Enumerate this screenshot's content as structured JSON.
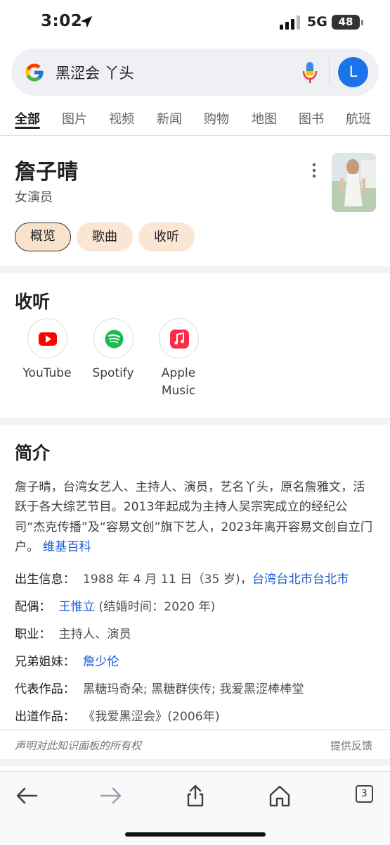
{
  "status_bar": {
    "time": "3:02",
    "network": "5G",
    "battery": "48"
  },
  "search": {
    "query": "黑涩会 丫头",
    "avatar_letter": "L"
  },
  "tabs": [
    "全部",
    "图片",
    "视频",
    "新闻",
    "购物",
    "地图",
    "图书",
    "航班"
  ],
  "entity": {
    "name": "詹子晴",
    "subtitle": "女演员",
    "chips": [
      "概览",
      "歌曲",
      "收听"
    ]
  },
  "listen": {
    "title": "收听",
    "apps": [
      {
        "label": "YouTube",
        "icon": "youtube-icon",
        "color": "#ff0000"
      },
      {
        "label": "Spotify",
        "icon": "spotify-icon",
        "color": "#1db954"
      },
      {
        "label": "Apple Music",
        "icon": "apple-music-icon",
        "color": "#fa2d48"
      }
    ]
  },
  "intro": {
    "title": "简介",
    "text": "詹子晴，台湾女艺人、主持人、演员，艺名丫头，原名詹雅文，活跃于各大综艺节目。2013年起成为主持人吴宗宪成立的经纪公司“杰克传播”及“容易文创”旗下艺人，2023年离开容易文创自立门户。",
    "source": "维基百科",
    "facts": [
      {
        "key": "出生信息：",
        "value": "1988 年 4 月 11 日（35 岁)，",
        "link": "台湾台北市台北市",
        "after": ""
      },
      {
        "key": "配偶：",
        "value": "",
        "link": "王惟立",
        "after": " (结婚时间：2020 年)"
      },
      {
        "key": "职业：",
        "value": "主持人、演员",
        "link": "",
        "after": ""
      },
      {
        "key": "兄弟姐妹：",
        "value": "",
        "link": "詹少伦",
        "after": ""
      },
      {
        "key": "代表作品：",
        "value": "黑糖玛奇朵; 黑糖群侠传; 我爱黑涩棒棒堂",
        "link": "",
        "after": ""
      },
      {
        "key": "出道作品：",
        "value": "《我爱黑涩会》(2006年)",
        "link": "",
        "after": ""
      }
    ]
  },
  "footer": {
    "claim": "声明对此知识面板的所有权",
    "feedback": "提供反馈"
  },
  "toolbar": {
    "tab_count": "3"
  }
}
